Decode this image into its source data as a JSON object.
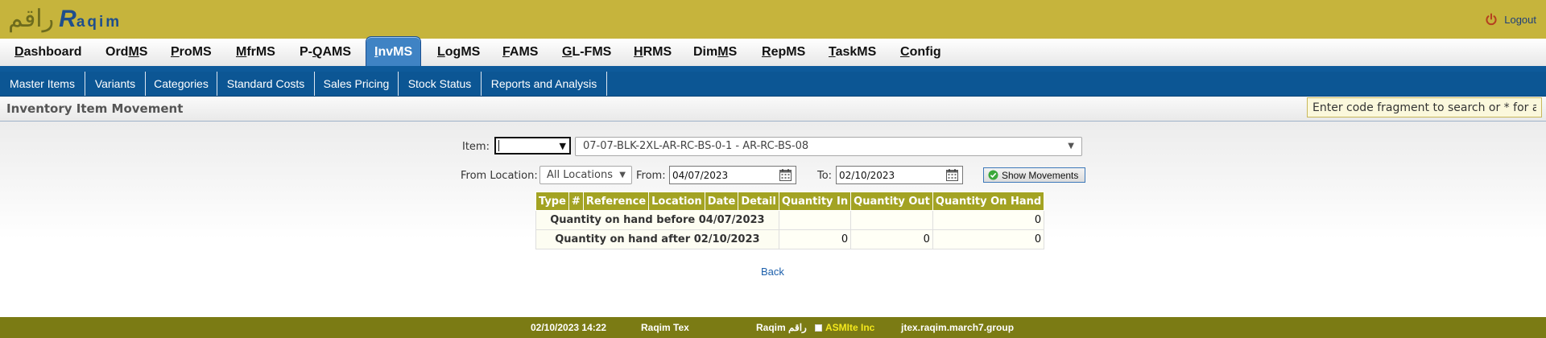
{
  "header": {
    "logo_arabic": "راقم",
    "logo_latin_initial": "R",
    "logo_latin_rest": "aqim",
    "logout_label": "Logout"
  },
  "main_menu": [
    {
      "label": "Dashboard",
      "hotkey": "D",
      "rest": "ashboard",
      "active": false
    },
    {
      "label": "OrdMS",
      "hotkey": "",
      "pre": "Ord",
      "hk": "M",
      "post": "S",
      "active": false
    },
    {
      "label": "ProMS",
      "pre": "",
      "hk": "P",
      "post": "roMS",
      "active": false
    },
    {
      "label": "MfrMS",
      "pre": "",
      "hk": "M",
      "post": "frMS",
      "active": false
    },
    {
      "label": "P-QAMS",
      "pre": "P-",
      "hk": "Q",
      "post": "AMS",
      "active": false
    },
    {
      "label": "InvMS",
      "pre": "",
      "hk": "I",
      "post": "nvMS",
      "active": true
    },
    {
      "label": "LogMS",
      "pre": "",
      "hk": "L",
      "post": "ogMS",
      "active": false
    },
    {
      "label": "FAMS",
      "pre": "",
      "hk": "F",
      "post": "AMS",
      "active": false
    },
    {
      "label": "GL-FMS",
      "pre": "",
      "hk": "G",
      "post": "L-FMS",
      "active": false
    },
    {
      "label": "HRMS",
      "pre": "",
      "hk": "H",
      "post": "RMS",
      "active": false
    },
    {
      "label": "DimMS",
      "pre": "Dim",
      "hk": "M",
      "post": "S",
      "active": false
    },
    {
      "label": "RepMS",
      "pre": "",
      "hk": "R",
      "post": "epMS",
      "active": false
    },
    {
      "label": "TaskMS",
      "pre": "",
      "hk": "T",
      "post": "askMS",
      "active": false
    },
    {
      "label": "Config",
      "pre": "",
      "hk": "C",
      "post": "onfig",
      "active": false
    }
  ],
  "sub_menu": [
    "Master Items",
    "Variants",
    "Categories",
    "Standard Costs",
    "Sales Pricing",
    "Stock Status",
    "Reports and Analysis"
  ],
  "page_title": "Inventory Item Movement",
  "search": {
    "placeholder": "Enter code fragment to search or * for all"
  },
  "form": {
    "item_label": "Item:",
    "item_code_value": "",
    "item_selected": "07-07-BLK-2XL-AR-RC-BS-0-1 - AR-RC-BS-08",
    "from_location_label": "From Location:",
    "location_selected": "All Locations",
    "from_label": "From:",
    "from_date": "04/07/2023",
    "to_label": "To:",
    "to_date": "02/10/2023",
    "show_button": "Show Movements"
  },
  "table": {
    "headers": [
      "Type",
      "#",
      "Reference",
      "Location",
      "Date",
      "Detail",
      "Quantity In",
      "Quantity Out",
      "Quantity On Hand"
    ],
    "before_row": {
      "label": "Quantity on hand before 04/07/2023",
      "qty_in": "",
      "qty_out": "",
      "on_hand": "0"
    },
    "after_row": {
      "label": "Quantity on hand after 02/10/2023",
      "qty_in": "0",
      "qty_out": "0",
      "on_hand": "0"
    }
  },
  "back_label": "Back",
  "footer": {
    "datetime": "02/10/2023 14:22",
    "company": "Raqim Tex",
    "product_latin": "Raqim",
    "product_arabic": "راقم",
    "vendor": "ASMIte Inc",
    "host": "jtex.raqim.march7.group"
  },
  "colors": {
    "header_bg": "#c6b43c",
    "submenu_bg": "#0c5694",
    "table_header": "#a3a323",
    "footer_bg": "#7b7b14",
    "vendor_text": "#f4e81d"
  }
}
